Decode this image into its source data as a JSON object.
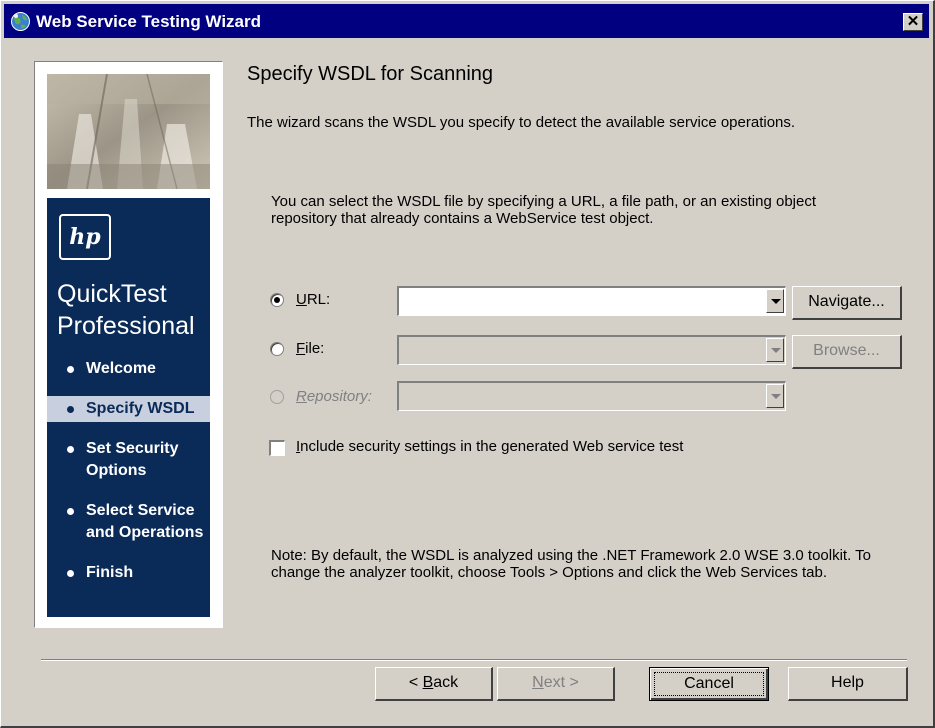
{
  "window": {
    "title": "Web Service Testing Wizard",
    "close_symbol": "✕",
    "app_icon": "globe-icon"
  },
  "sidebar": {
    "logo_text": "hp",
    "product_line1": "QuickTest",
    "product_line2": "Professional",
    "steps": [
      {
        "label": "Welcome",
        "active": false
      },
      {
        "label": "Specify WSDL",
        "active": true
      },
      {
        "label": "Set Security Options",
        "active": false
      },
      {
        "label": "Select Service and Operations",
        "active": false
      },
      {
        "label": "Finish",
        "active": false
      }
    ]
  },
  "main": {
    "heading": "Specify WSDL for Scanning",
    "intro": "The wizard scans the WSDL you specify to detect the available service operations.",
    "description": "You can select the WSDL file by specifying a URL, a file path, or an existing object repository that already contains a WebService test object.",
    "source": {
      "url": {
        "label_key": "U",
        "label_rest": "RL:",
        "value": "",
        "checked": true,
        "enabled": true,
        "button": "Navigate..."
      },
      "file": {
        "label_key": "F",
        "label_rest": "ile:",
        "value": "",
        "checked": false,
        "enabled": false,
        "button": "Browse..."
      },
      "repository": {
        "label_key": "R",
        "label_rest": "epository:",
        "value": "",
        "checked": false,
        "enabled": false
      }
    },
    "security_checkbox": {
      "label_key": "I",
      "label_rest": "nclude security settings in the generated Web service test",
      "checked": false
    },
    "note": "Note: By default, the WSDL is analyzed using the .NET Framework 2.0 WSE 3.0 toolkit. To change the analyzer toolkit, choose Tools > Options and click the Web Services tab."
  },
  "footer": {
    "back_prefix": "< ",
    "back_key": "B",
    "back_rest": "ack",
    "next_key": "N",
    "next_rest": "ext >",
    "cancel": "Cancel",
    "help": "Help"
  },
  "colors": {
    "title_bar": "#000080",
    "sidebar_panel": "#0a2a58",
    "dialog_face": "#d4d0c8",
    "active_step": "#c8d0e0"
  }
}
